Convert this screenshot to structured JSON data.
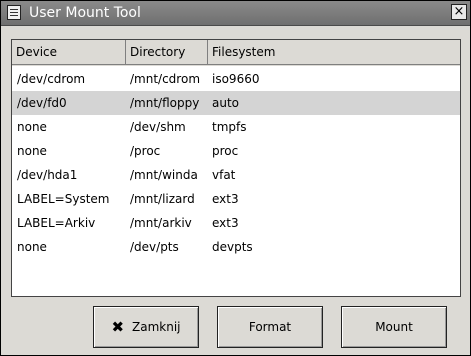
{
  "window": {
    "title": "User Mount Tool",
    "close_glyph": "×"
  },
  "table": {
    "columns": [
      "Device",
      "Directory",
      "Filesystem"
    ],
    "rows": [
      [
        "/dev/cdrom",
        "/mnt/cdrom",
        "iso9660"
      ],
      [
        "/dev/fd0",
        "/mnt/floppy",
        "auto"
      ],
      [
        "none",
        "/dev/shm",
        "tmpfs"
      ],
      [
        "none",
        "/proc",
        "proc"
      ],
      [
        "/dev/hda1",
        "/mnt/winda",
        "vfat"
      ],
      [
        "LABEL=System",
        "/mnt/lizard",
        "ext3"
      ],
      [
        "LABEL=Arkiv",
        "/mnt/arkiv",
        "ext3"
      ],
      [
        "none",
        "/dev/pts",
        "devpts"
      ]
    ],
    "selected_row": 1
  },
  "buttons": {
    "close_label": "Zamknij",
    "close_icon": "✖",
    "format_label": "Format",
    "mount_label": "Mount"
  }
}
